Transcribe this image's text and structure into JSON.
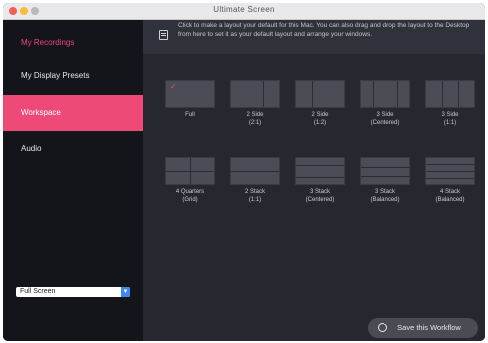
{
  "window": {
    "title": "Ultimate Screen"
  },
  "sidebar": {
    "items": [
      {
        "label": "My Recordings"
      },
      {
        "label": "My Display Presets"
      },
      {
        "label": "Workspace"
      },
      {
        "label": "Audio"
      }
    ],
    "selector": {
      "value": "Full Screen"
    }
  },
  "banner": {
    "text": "Click to make a layout your default for this Mac. You can also drag and drop the layout to the Desktop from here to set it as your default layout and arrange your windows."
  },
  "layouts": [
    {
      "label": "Full",
      "checked": true
    },
    {
      "label": "2 Side\n(2:1)"
    },
    {
      "label": "2 Side\n(1:2)"
    },
    {
      "label": "3 Side\n(Centered)"
    },
    {
      "label": "3 Side\n(1:1)"
    },
    {
      "label": "4 Quarters\n(Grid)"
    },
    {
      "label": "2 Stack\n(1:1)"
    },
    {
      "label": "3 Stack\n(Centered)"
    },
    {
      "label": "3 Stack\n(Balanced)"
    },
    {
      "label": "4 Stack\n(Balanced)"
    }
  ],
  "actions": {
    "save_label": "Save this Workflow"
  },
  "colors": {
    "accent": "#ef4a77",
    "sidebar_bg": "#14151a",
    "main_bg": "#262830"
  }
}
